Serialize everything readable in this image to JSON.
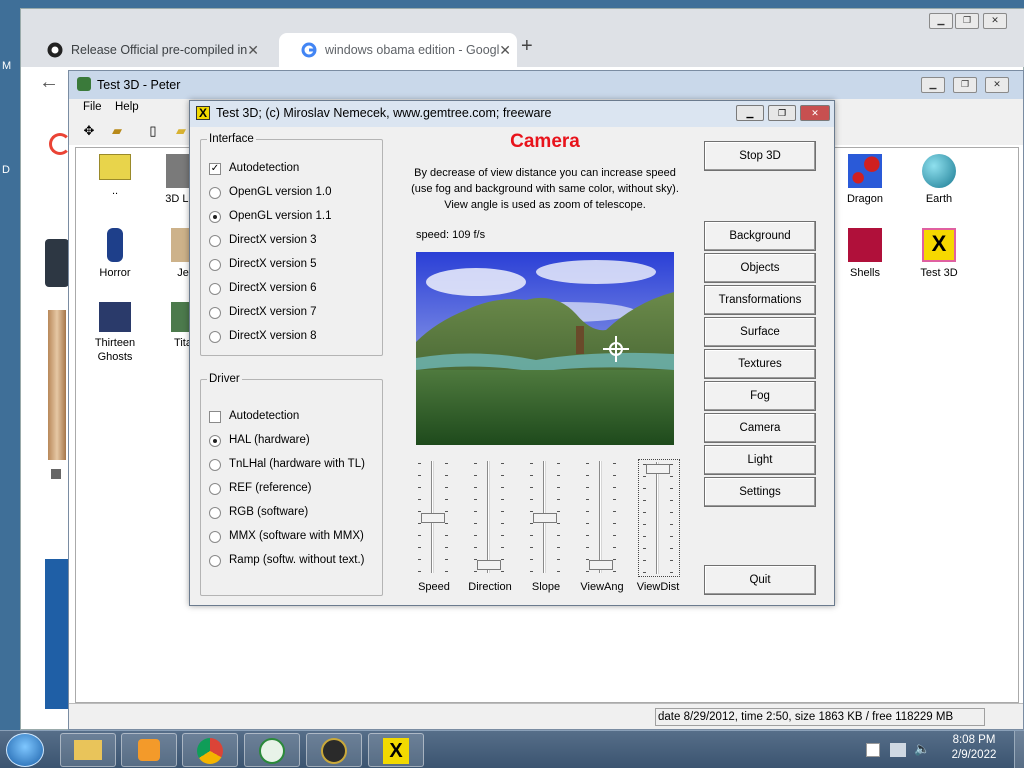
{
  "chrome": {
    "tabs": [
      {
        "label": "Release Official pre-compiled in",
        "icon": "github-icon"
      },
      {
        "label": "windows obama edition - Googl",
        "icon": "google-icon"
      }
    ],
    "new_tab_symbol": "+",
    "back_symbol": "←"
  },
  "peter_window": {
    "title": "Test 3D - Peter",
    "menu": [
      "File",
      "Help"
    ],
    "files": [
      {
        "label": "..",
        "icon": "parent-folder-icon"
      },
      {
        "label": "3D Lun",
        "icon": "model-icon"
      },
      {
        "label": "Horror",
        "icon": "horror-icon"
      },
      {
        "label": "Je",
        "icon": "model-icon"
      },
      {
        "label": "Thirteen Ghosts",
        "icon": "ghosts-icon"
      },
      {
        "label": "Tita",
        "icon": "model-icon"
      },
      {
        "label": "Dragon",
        "icon": "dragon-icon"
      },
      {
        "label": "Earth",
        "icon": "earth-icon"
      },
      {
        "label": "Shells",
        "icon": "shells-icon"
      },
      {
        "label": "Test 3D",
        "icon": "test3d-icon"
      }
    ],
    "status": "date 8/29/2012, time 2:50, size 1863 KB / free 118229 MB"
  },
  "dialog": {
    "title": "Test 3D;  (c) Miroslav Nemecek, www.gemtree.com;  freeware",
    "interface": {
      "legend": "Interface",
      "autodetect": {
        "label": "Autodetection",
        "checked": true
      },
      "options": [
        "OpenGL version 1.0",
        "OpenGL version 1.1",
        "DirectX version 3",
        "DirectX version 5",
        "DirectX version 6",
        "DirectX version 7",
        "DirectX version 8"
      ],
      "selected": "OpenGL version 1.1"
    },
    "driver": {
      "legend": "Driver",
      "autodetect": {
        "label": "Autodetection",
        "checked": false
      },
      "options": [
        "HAL (hardware)",
        "TnLHal (hardware with TL)",
        "REF (reference)",
        "RGB (software)",
        "MMX (software with MMX)",
        "Ramp (softw. without text.)"
      ],
      "selected": "HAL (hardware)"
    },
    "camera_title": "Camera",
    "description": [
      "By decrease of view distance you can increase speed",
      "(use fog and background with same color, without sky).",
      "View angle is used as zoom of telescope."
    ],
    "speed": "speed: 109 f/s",
    "sliders": [
      {
        "label": "Speed",
        "level": 0.5
      },
      {
        "label": "Direction",
        "level": 0.05
      },
      {
        "label": "Slope",
        "level": 0.5
      },
      {
        "label": "ViewAng",
        "level": 0.05
      },
      {
        "label": "ViewDist",
        "level": 0.98
      }
    ],
    "buttons": {
      "stop": "Stop 3D",
      "menu": [
        "Background",
        "Objects",
        "Transformations",
        "Surface",
        "Textures",
        "Fog",
        "Camera",
        "Light",
        "Settings"
      ],
      "quit": "Quit"
    }
  },
  "taskbar": {
    "time": "8:08 PM",
    "date": "2/9/2022"
  },
  "colors": {
    "camera_title": "#e8131b",
    "desktop": "#3f6f98"
  }
}
